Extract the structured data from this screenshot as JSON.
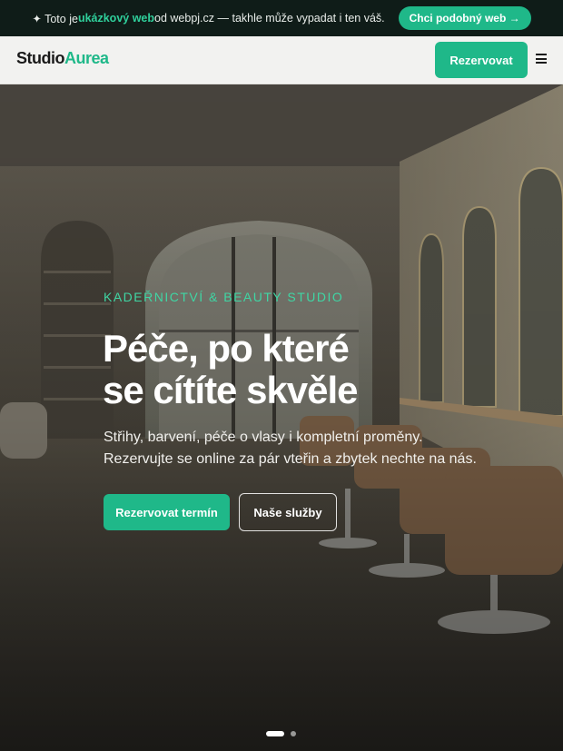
{
  "promo": {
    "prefix": "✦ Toto je ",
    "highlight": "ukázkový web",
    "suffix": " od webpj.cz — takhle může vypadat i ten váš.",
    "cta": "Chci podobný web →"
  },
  "header": {
    "logo_part1": "Studio",
    "logo_part2": "Aurea",
    "book_button": "Rezervovat",
    "menu_icon": "hamburger-icon"
  },
  "hero": {
    "eyebrow": "KADEŘNICTVÍ & BEAUTY STUDIO",
    "headline_line1": "Péče, po které",
    "headline_line2": "se cítíte skvěle",
    "sub_line1": "Střihy, barvení, péče o vlasy i kompletní proměny.",
    "sub_line2": "Rezervujte se online za pár vteřin a zbytek nechte na nás.",
    "primary_button": "Rezervovat termín",
    "secondary_button": "Naše služby",
    "slides": {
      "count": 2,
      "active": 1
    }
  },
  "colors": {
    "accent": "#1fb889",
    "eyebrow": "#3fd6a4",
    "banner_bg": "#0f1c18",
    "header_bg": "#f2f2f0"
  }
}
